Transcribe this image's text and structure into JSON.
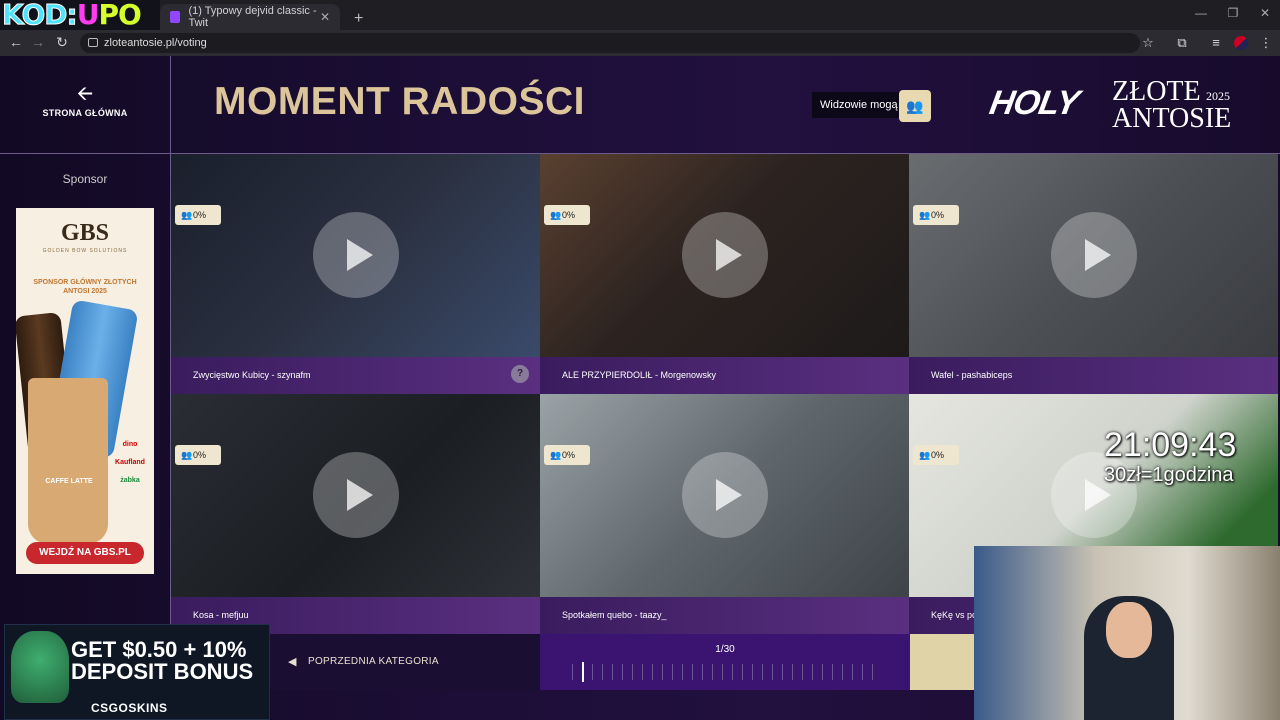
{
  "browser": {
    "stream_logo": {
      "part1": "KOD:",
      "part2": "U",
      "part3": "PO"
    },
    "tabs": [
      {
        "title": "(1) Typowy dejvid classic - Twit"
      }
    ],
    "url": "zloteantosie.pl/voting"
  },
  "header": {
    "back_label": "STRONA GŁÓWNA",
    "category_title": "MOMENT RADOŚCI",
    "viewers_label": "Widzowie mogą",
    "logo_holy": "HOLY",
    "logo_zlote": "ZŁOTE",
    "logo_antosie": "ANTOSIE",
    "logo_year": "2025"
  },
  "sponsor": {
    "label": "Sponsor",
    "ad": {
      "brand": "GBS",
      "brand_sub": "GOLDEN BOW SOLUTIONS",
      "sponsor_text": "SPONSOR GŁÓWNY ZŁOTYCH ANTOSI 2025",
      "product": "CAFFE LATTE",
      "retail": [
        "dino",
        "Kaufland",
        "żabka"
      ],
      "cta": "WEJDŹ NA GBS.PL"
    }
  },
  "clips": [
    {
      "title": "Zwycięstwo Kubicy - szynafm",
      "percent": "0%",
      "thumb_color": "#1d2433",
      "has_help": true
    },
    {
      "title": "ALE PRZYPIERDOLIŁ - Morgenowsky",
      "percent": "0%",
      "thumb_color": "#3a2e2a"
    },
    {
      "title": "Wafel - pashabiceps",
      "percent": "0%",
      "thumb_color": "#4d5055"
    },
    {
      "title": "Kosa - mefjuu",
      "percent": "0%",
      "thumb_color": "#22262c"
    },
    {
      "title": "Spotkałem quebo - taazy_",
      "percent": "0%",
      "thumb_color": "#6b6f72"
    },
    {
      "title": "KęKę vs pc",
      "percent": "0%",
      "thumb_color": "#d9d9d2"
    }
  ],
  "footer": {
    "prev_category": "POPRZEDNIA KATEGORIA",
    "page_indicator": "1/30",
    "progress_fraction": 0.0333
  },
  "overlays": {
    "bonus_headline_1": "GET $0.50 + 10%",
    "bonus_headline_2": "DEPOSIT BONUS",
    "bonus_brand": "CSGOSKINS",
    "timer": "21:09:43",
    "rate": "30zł=1godzina"
  }
}
